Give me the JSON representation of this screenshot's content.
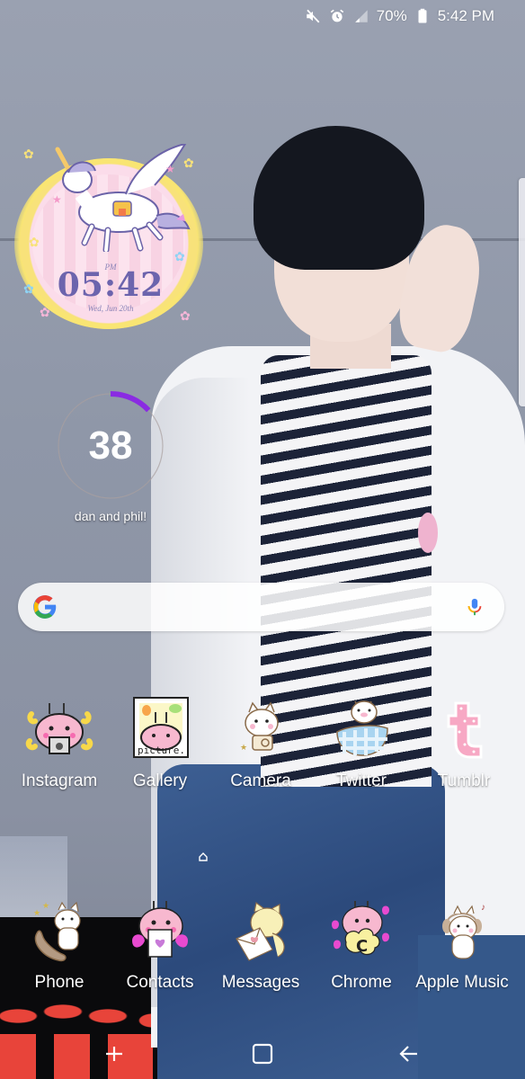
{
  "status_bar": {
    "icons": [
      "mute-icon",
      "alarm-icon",
      "signal-icon",
      "battery-icon"
    ],
    "battery_percent": "70%",
    "time": "5:42 PM"
  },
  "clock_widget": {
    "ampm": "PM",
    "time": "05:42",
    "date": "Wed, Jun 20th"
  },
  "counter_widget": {
    "value": "38",
    "label": "dan and phil!",
    "progress_fraction": 0.13,
    "accent_color": "#8a2be2"
  },
  "search_bar": {
    "placeholder": "",
    "google_icon": "google-g-icon",
    "mic_icon": "microphone-icon"
  },
  "apps_row1": [
    {
      "label": "Instagram",
      "icon": "bunny-camera-icon"
    },
    {
      "label": "Gallery",
      "icon": "bunny-polaroid-icon",
      "icon_text": "picture.."
    },
    {
      "label": "Camera",
      "icon": "cat-camera-icon"
    },
    {
      "label": "Twitter",
      "icon": "pig-gingham-egg-icon"
    },
    {
      "label": "Tumblr",
      "icon": "polka-dot-t-icon"
    }
  ],
  "dock": [
    {
      "label": "Phone",
      "icon": "cat-phone-icon"
    },
    {
      "label": "Contacts",
      "icon": "bunny-notebook-icon"
    },
    {
      "label": "Messages",
      "icon": "cat-letter-icon"
    },
    {
      "label": "Chrome",
      "icon": "bunny-c-cloud-icon",
      "icon_text": "C"
    },
    {
      "label": "Apple Music",
      "icon": "cat-headphones-icon"
    }
  ],
  "nav_bar": {
    "recent": "recent-apps-icon",
    "home": "home-icon",
    "back": "back-icon"
  },
  "colors": {
    "google_blue": "#4285f4",
    "google_red": "#ea4335",
    "google_yellow": "#fbbc05",
    "google_green": "#34a853",
    "clock_text": "#6c64ad"
  }
}
